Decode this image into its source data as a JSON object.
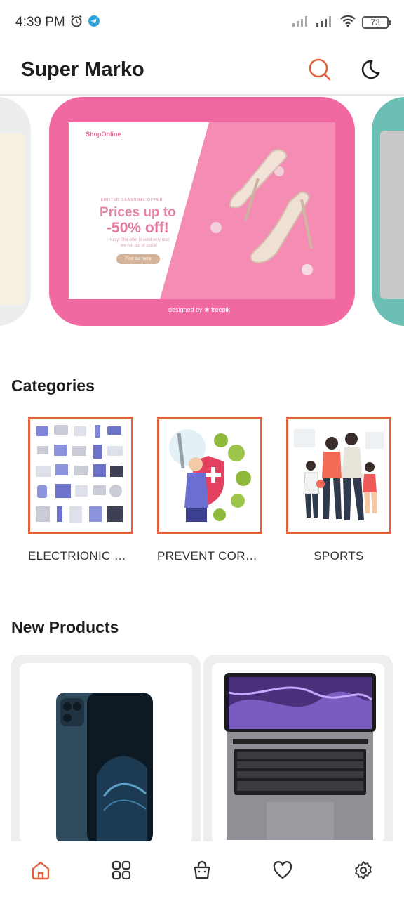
{
  "status_bar": {
    "time": "4:39 PM",
    "battery": "73",
    "icons": [
      "alarm-icon",
      "telegram-icon",
      "signal-icon",
      "signal-icon",
      "wifi-icon",
      "battery-icon"
    ]
  },
  "app_bar": {
    "title": "Super Marko",
    "actions": [
      "search-icon",
      "moon-icon"
    ],
    "accent_color": "#e0613c"
  },
  "banner": {
    "brand": "ShopOnline",
    "kicker": "LIMITED SEASONAL OFFER",
    "headline_1": "Prices up to",
    "headline_2": "-50% off!",
    "note": "Hurry! The offer is valid only until we run out of stock!",
    "cta": "Find out more",
    "credit": "designed by ❀ freepik"
  },
  "categories": {
    "title": "Categories",
    "items": [
      {
        "label": "ELECTRIONIC DE..."
      },
      {
        "label": "PREVENT CORO..."
      },
      {
        "label": "SPORTS"
      }
    ]
  },
  "new_products": {
    "title": "New Products",
    "items": [
      {
        "image": "smartphone-image"
      },
      {
        "image": "laptop-image"
      }
    ]
  },
  "bottom_nav": {
    "items": [
      "home-icon",
      "grid-icon",
      "bag-icon",
      "heart-icon",
      "settings-icon"
    ],
    "active": "home-icon"
  }
}
